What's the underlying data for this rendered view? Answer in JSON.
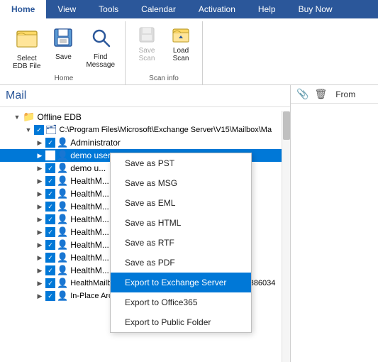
{
  "tabs": [
    {
      "label": "Home",
      "active": true
    },
    {
      "label": "View",
      "active": false
    },
    {
      "label": "Tools",
      "active": false
    },
    {
      "label": "Calendar",
      "active": false
    },
    {
      "label": "Activation",
      "active": false
    },
    {
      "label": "Help",
      "active": false
    },
    {
      "label": "Buy Now",
      "active": false
    }
  ],
  "ribbon": {
    "groups": [
      {
        "label": "Home",
        "items": [
          {
            "label": "Select\nEDB File",
            "icon": "📁",
            "size": "large",
            "disabled": false
          },
          {
            "label": "Save",
            "icon": "💾",
            "size": "large",
            "disabled": false
          },
          {
            "label": "Find\nMessage",
            "icon": "🔍",
            "size": "large",
            "disabled": false
          }
        ]
      },
      {
        "label": "Scan info",
        "items": [
          {
            "label": "Save\nScan",
            "icon": "📄",
            "size": "large",
            "disabled": true
          },
          {
            "label": "Load\nScan",
            "icon": "📂",
            "size": "large",
            "disabled": false
          }
        ]
      }
    ]
  },
  "panel_title": "Mail",
  "tree": {
    "root_label": "Offline EDB",
    "path_label": "C:\\Program Files\\Microsoft\\Exchange Server\\V15\\Mailbox\\Ma",
    "items": [
      {
        "label": "Administrator",
        "indent": 3,
        "checked": true
      },
      {
        "label": "demo user",
        "indent": 3,
        "checked": true,
        "highlighted": true
      },
      {
        "label": "demo u...",
        "indent": 3,
        "checked": true
      },
      {
        "label": "HealthM...",
        "indent": 3,
        "checked": true
      },
      {
        "label": "HealthM...",
        "indent": 3,
        "checked": true
      },
      {
        "label": "HealthM...",
        "indent": 3,
        "checked": true
      },
      {
        "label": "HealthM...",
        "indent": 3,
        "checked": true
      },
      {
        "label": "HealthM...",
        "indent": 3,
        "checked": true
      },
      {
        "label": "HealthM...",
        "indent": 3,
        "checked": true
      },
      {
        "label": "HealthM...",
        "indent": 3,
        "checked": true
      },
      {
        "label": "HealthM...",
        "indent": 3,
        "checked": true
      },
      {
        "label": "HealthMailbox-stellarexch1-Mailbox-Database-1300386034",
        "indent": 3,
        "checked": true
      },
      {
        "label": "In-Place Archive -HealthMailbox-stellarexch1-001",
        "indent": 3,
        "checked": true
      }
    ]
  },
  "context_menu": {
    "items": [
      {
        "label": "Save as PST",
        "highlighted": false
      },
      {
        "label": "Save as MSG",
        "highlighted": false
      },
      {
        "label": "Save as EML",
        "highlighted": false
      },
      {
        "label": "Save as HTML",
        "highlighted": false
      },
      {
        "label": "Save as RTF",
        "highlighted": false
      },
      {
        "label": "Save as PDF",
        "highlighted": false
      },
      {
        "label": "Export to Exchange Server",
        "highlighted": true
      },
      {
        "label": "Export to Office365",
        "highlighted": false
      },
      {
        "label": "Export to Public Folder",
        "highlighted": false
      }
    ]
  },
  "right_panel": {
    "clip_icon": "📎",
    "trash_icon": "🗑",
    "from_label": "From"
  }
}
